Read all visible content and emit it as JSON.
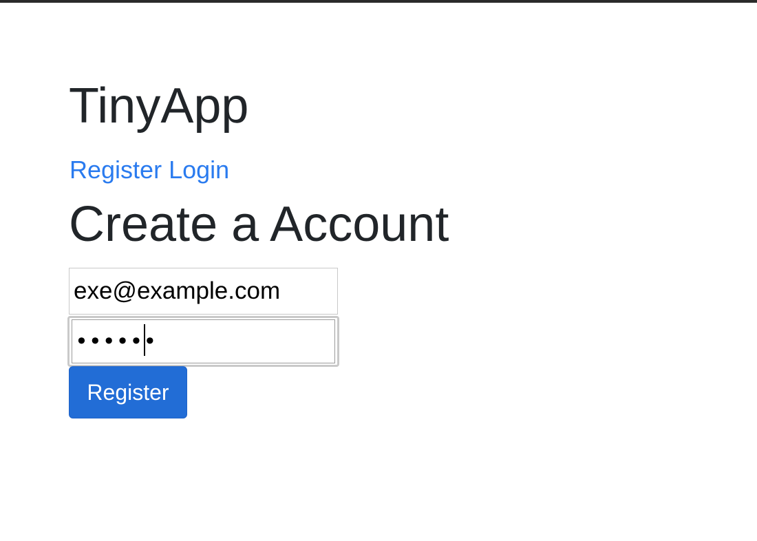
{
  "app": {
    "title": "TinyApp"
  },
  "nav": {
    "register_label": "Register",
    "login_label": "Login"
  },
  "page": {
    "heading": "Create a Account"
  },
  "form": {
    "email_value": "exe@example.com",
    "password_value": "••••••",
    "submit_label": "Register"
  },
  "colors": {
    "link": "#2a7bef",
    "button_bg": "#226dd6",
    "text": "#212529"
  }
}
